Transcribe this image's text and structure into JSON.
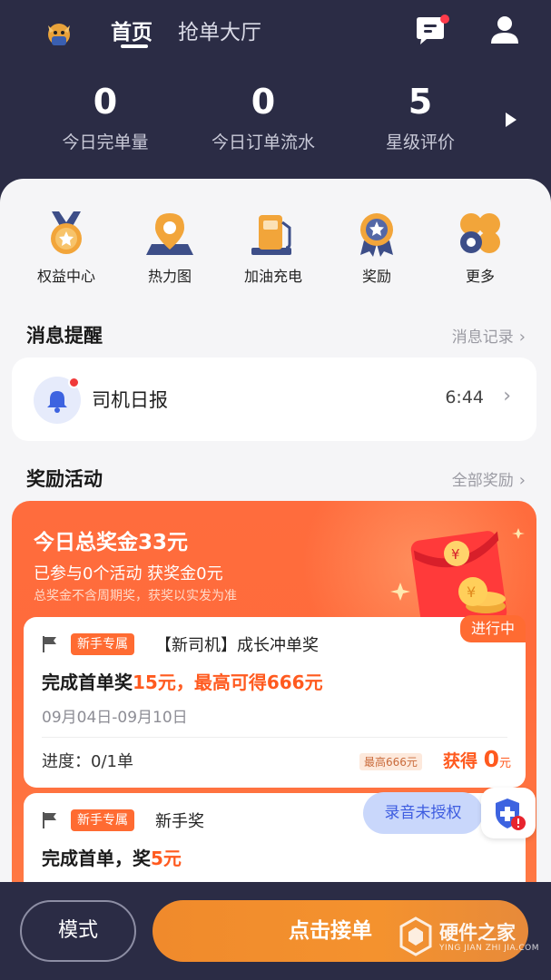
{
  "header": {
    "tabs": [
      {
        "label": "首页",
        "active": true
      },
      {
        "label": "抢单大厅",
        "active": false
      }
    ],
    "icons": [
      "app-logo-icon",
      "message-icon",
      "user-icon"
    ]
  },
  "stats": [
    {
      "value": "0",
      "label": "今日完单量"
    },
    {
      "value": "0",
      "label": "今日订单流水"
    },
    {
      "value": "5",
      "label": "星级评价"
    }
  ],
  "quick_actions": [
    {
      "label": "权益中心",
      "icon": "medal-icon"
    },
    {
      "label": "热力图",
      "icon": "map-pin-icon"
    },
    {
      "label": "加油充电",
      "icon": "fuel-pump-icon"
    },
    {
      "label": "奖励",
      "icon": "award-icon"
    },
    {
      "label": "更多",
      "icon": "more-grid-icon"
    }
  ],
  "messages": {
    "title": "消息提醒",
    "link": "消息记录",
    "item": {
      "name": "司机日报",
      "time": "6:44",
      "icon": "bell-icon"
    }
  },
  "rewards": {
    "title": "奖励活动",
    "link": "全部奖励",
    "total": "今日总奖金33元",
    "joined": "已参与0个活动 获奖金0元",
    "note": "总奖金不含周期奖，获奖以实发为准",
    "tasks": [
      {
        "status": "进行中",
        "tag": "新手专属",
        "name": "【新司机】成长冲单奖",
        "title_prefix": "完成首单奖",
        "title_highlight": "15元，最高可得666元",
        "date": "09月04日-09月10日",
        "progress": "进度：0/1单",
        "max": "最高666元",
        "earn_label": "获得",
        "earn_value": "0",
        "earn_unit": "元"
      },
      {
        "tag": "新手专属",
        "name": "新手奖",
        "title_prefix": "完成首单，奖",
        "title_highlight": "5元"
      }
    ]
  },
  "floating": {
    "record": "录音未授权"
  },
  "bottom": {
    "mode": "模式",
    "accept": "点击接单"
  },
  "watermark": {
    "text": "硬件之家",
    "sub": "YING JIAN ZHI JIA.COM"
  },
  "colors": {
    "header_bg": "#2b2c45",
    "accent_orange": "#ff6b32",
    "accept_button": "#f08a2c",
    "panel_bg": "#f5f5f7"
  }
}
